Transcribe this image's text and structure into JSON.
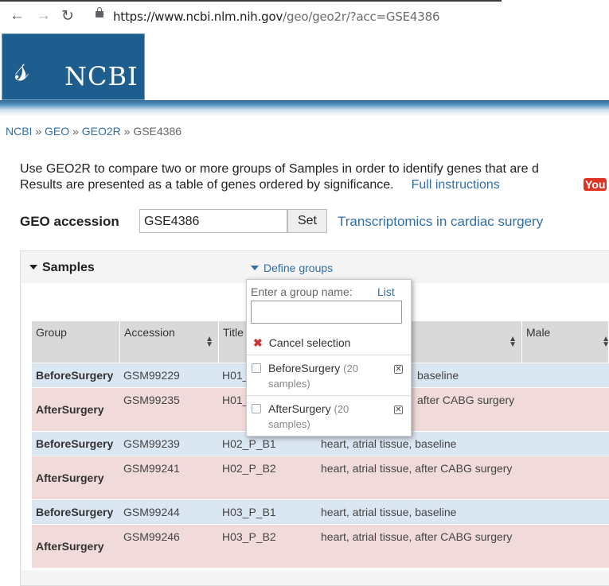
{
  "browser": {
    "url_host": "https://www.ncbi.nlm.nih.gov",
    "url_path": "/geo/geo2r/?acc=GSE4386"
  },
  "header": {
    "logo_text": "NCBI"
  },
  "breadcrumb": [
    "NCBI",
    "GEO",
    "GEO2R",
    "GSE4386"
  ],
  "intro": {
    "line1": "Use GEO2R to compare two or more groups of Samples in order to identify genes that are d",
    "line2": "Results are presented as a table of genes ordered by significance.",
    "link": "Full instructions",
    "video": "You"
  },
  "accession": {
    "label": "GEO accession",
    "value": "GSE4386",
    "set_label": "Set",
    "study_link": "Transcriptomics in cardiac surgery"
  },
  "samples": {
    "title": "Samples",
    "define_groups": "Define groups",
    "columns": [
      "Group",
      "Accession",
      "Title",
      "",
      "Male"
    ],
    "rows": [
      {
        "group": "BeforeSurgery",
        "accession": "GSM99229",
        "title": "H01_",
        "source": "baseline"
      },
      {
        "group": "AfterSurgery",
        "accession": "GSM99235",
        "title": "H01_",
        "source": "after CABG surgery"
      },
      {
        "group": "BeforeSurgery",
        "accession": "GSM99239",
        "title": "H02_P_B1",
        "source": "heart, atrial tissue, baseline"
      },
      {
        "group": "AfterSurgery",
        "accession": "GSM99241",
        "title": "H02_P_B2",
        "source": "heart, atrial tissue, after CABG surgery"
      },
      {
        "group": "BeforeSurgery",
        "accession": "GSM99244",
        "title": "H03_P_B1",
        "source": "heart, atrial tissue, baseline"
      },
      {
        "group": "AfterSurgery",
        "accession": "GSM99246",
        "title": "H03_P_B2",
        "source": "heart, atrial tissue, after CABG surgery"
      }
    ]
  },
  "popup": {
    "prompt": "Enter a group name:",
    "list_link": "List",
    "input_value": "",
    "cancel": "Cancel selection",
    "groups": [
      {
        "name": "BeforeSurgery",
        "count": "(20",
        "count2": "samples)"
      },
      {
        "name": "AfterSurgery",
        "count": "(20",
        "count2": "samples)"
      }
    ]
  },
  "colors": {
    "before_row": "#dbe6f3",
    "after_row": "#f1dada",
    "link": "#2f6fa7",
    "logo_bg": "#1e5e8e"
  }
}
